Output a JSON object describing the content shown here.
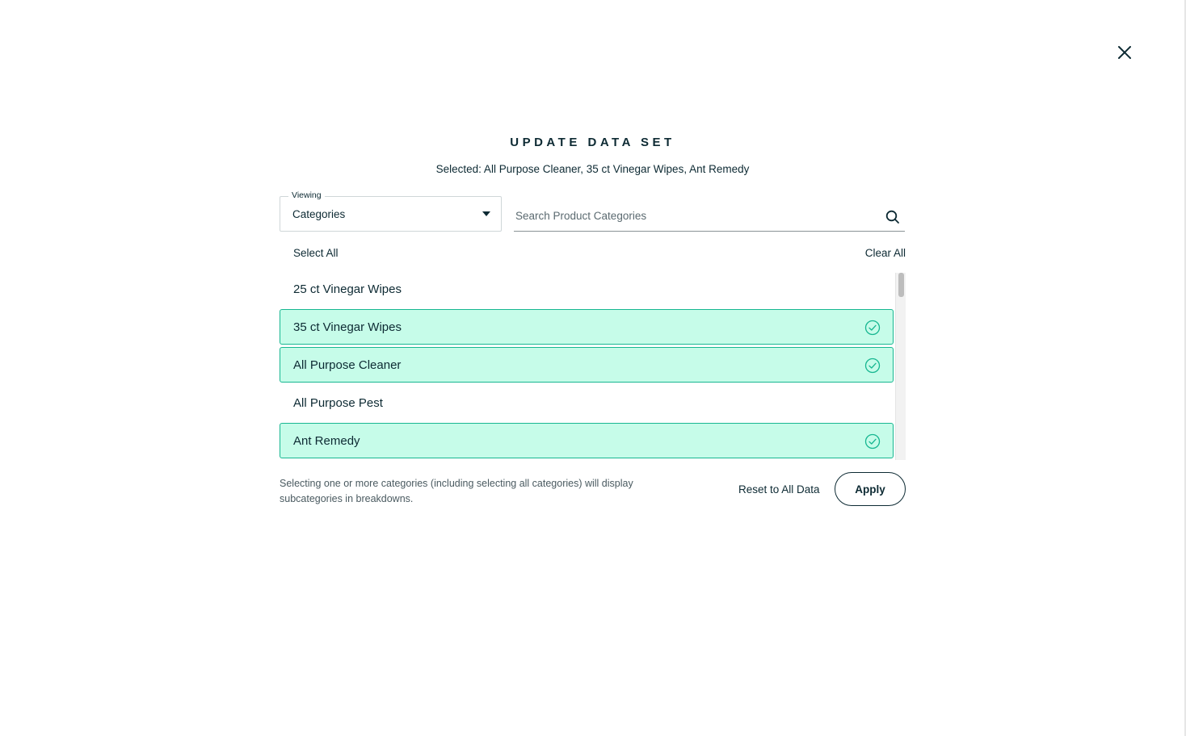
{
  "modal": {
    "title": "UPDATE DATA SET",
    "selected_text": "Selected: All Purpose Cleaner, 35 ct Vinegar Wipes, Ant Remedy"
  },
  "close": {
    "icon": "close-icon"
  },
  "viewing": {
    "legend": "Viewing",
    "value": "Categories",
    "icon": "caret-down-icon"
  },
  "search": {
    "placeholder": "Search Product Categories",
    "value": "",
    "icon": "search-icon"
  },
  "actions": {
    "select_all": "Select All",
    "clear_all": "Clear All"
  },
  "items": [
    {
      "label": "25 ct Vinegar Wipes",
      "selected": false
    },
    {
      "label": "35 ct Vinegar Wipes",
      "selected": true
    },
    {
      "label": "All Purpose Cleaner",
      "selected": true
    },
    {
      "label": "All Purpose Pest",
      "selected": false
    },
    {
      "label": "Ant Remedy",
      "selected": true
    }
  ],
  "footer": {
    "note": "Selecting one or more categories (including selecting all categories) will display subcategories in breakdowns.",
    "reset_label": "Reset to All Data",
    "apply_label": "Apply"
  },
  "colors": {
    "text": "#0d2a33",
    "selected_bg": "#c6fce9",
    "selected_border": "#17b791",
    "check": "#17b791"
  }
}
